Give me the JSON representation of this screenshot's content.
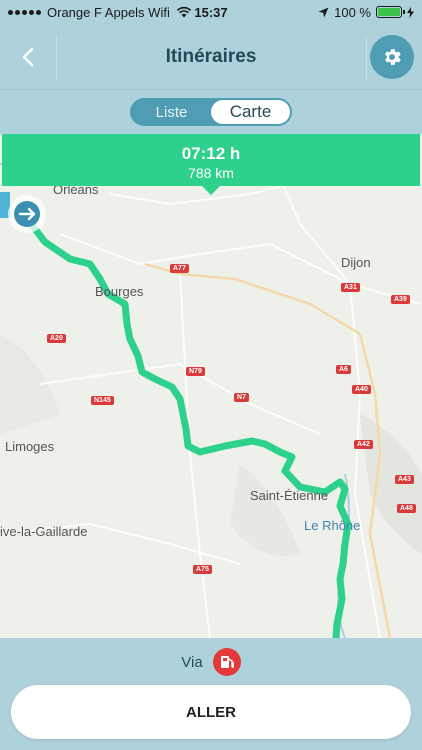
{
  "status_bar": {
    "carrier": "Orange F Appels Wifi",
    "time": "15:37",
    "battery_level": "100 %"
  },
  "header": {
    "title": "Itinéraires"
  },
  "view_toggle": {
    "list_label": "Liste",
    "map_label": "Carte",
    "selected": "Carte"
  },
  "route_summary": {
    "duration": "07:12 h",
    "distance": "788 km"
  },
  "map": {
    "cities": [
      "Orléans",
      "Bourges",
      "Dijon",
      "Limoges",
      "Saint-Étienne",
      "ive-la-Gaillarde"
    ],
    "rivers": [
      "Le Rhône"
    ],
    "roads": [
      "A77",
      "A31",
      "A39",
      "A20",
      "N79",
      "A6",
      "A40",
      "N7",
      "N145",
      "A42",
      "A43",
      "A48",
      "A75"
    ],
    "route_color": "#2ed18c"
  },
  "bottom": {
    "via_label": "Via",
    "via_icon": "gas-station-icon",
    "go_label": "ALLER"
  },
  "colors": {
    "header_bg": "#aed2dc",
    "accent": "#4e9db3",
    "route_green": "#2ed18c"
  }
}
